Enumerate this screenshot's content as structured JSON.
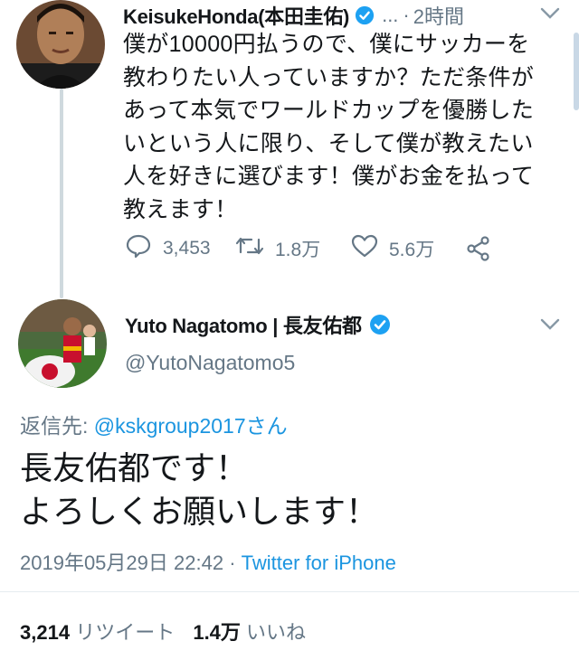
{
  "tweet1": {
    "display_name": "KeisukeHonda(本田圭佑)",
    "ellipsis": "...",
    "separator": "·",
    "time": "2時間",
    "text_lines": [
      "僕が10000円払うので、僕にサッカーを",
      "教わりたい人っていますか？ただ条件が",
      "あって本気でワールドカップを優勝した",
      "いという人に限り、そして僕が教えたい",
      "人を好きに選びます！僕がお金を払って",
      "教えます！"
    ],
    "reply_count": "3,453",
    "retweet_count": "1.8万",
    "like_count": "5.6万"
  },
  "tweet2": {
    "display_name": "Yuto Nagatomo | 長友佑都",
    "handle": "@YutoNagatomo5",
    "reply_to_label": "返信先:",
    "reply_to_handle": "@kskgroup2017さん",
    "text_lines": [
      "長友佑都です！",
      "よろしくお願いします！"
    ],
    "date": "2019年05月29日 22:42",
    "source_separator": "·",
    "source": "Twitter for iPhone",
    "retweet_count": "3,214",
    "retweet_label": "リツイート",
    "like_count": "1.4万",
    "like_label": "いいね"
  },
  "colors": {
    "accent": "#1da1f2",
    "link": "#1b95e0",
    "secondary_text": "#657786",
    "text": "#14171a"
  },
  "icons": [
    "verified-badge-icon",
    "chevron-down-icon",
    "reply-icon",
    "retweet-icon",
    "like-icon",
    "share-icon"
  ]
}
